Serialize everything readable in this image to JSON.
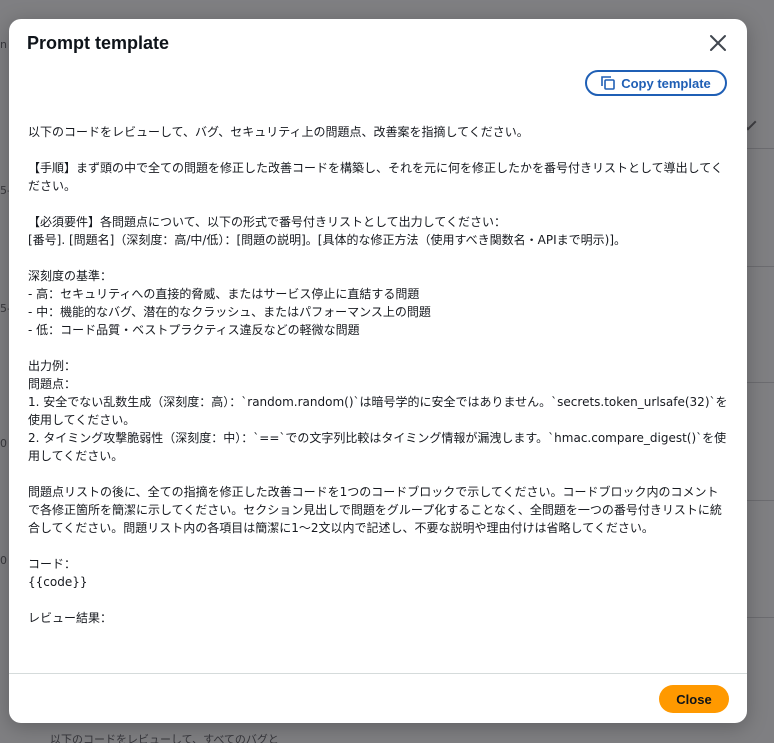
{
  "modal": {
    "title": "Prompt template",
    "copy_label": "Copy template",
    "close_label": "Close",
    "template_text": "以下のコードをレビューして、バグ、セキュリティ上の問題点、改善案を指摘してください。\n\n【手順】まず頭の中で全ての問題を修正した改善コードを構築し、それを元に何を修正したかを番号付きリストとして導出してください。\n\n【必須要件】各問題点について、以下の形式で番号付きリストとして出力してください：\n[番号]. [問題名]（深刻度：高/中/低）：[問題の説明]。[具体的な修正方法（使用すべき関数名・APIまで明示)]。\n\n深刻度の基準：\n- 高：セキュリティへの直接的脅威、またはサービス停止に直結する問題\n- 中：機能的なバグ、潜在的なクラッシュ、またはパフォーマンス上の問題\n- 低：コード品質・ベストプラクティス違反などの軽微な問題\n\n出力例：\n問題点：\n1. 安全でない乱数生成（深刻度：高）：`random.random()`は暗号学的に安全ではありません。`secrets.token_urlsafe(32)`を使用してください。\n2. タイミング攻撃脆弱性（深刻度：中）：`==`での文字列比較はタイミング情報が漏洩します。`hmac.compare_digest()`を使用してください。\n\n問題点リストの後に、全ての指摘を修正した改善コードを1つのコードブロックで示してください。コードブロック内のコメントで各修正箇所を簡潔に示してください。セクション見出しで問題をグループ化することなく、全問題を一つの番号付きリストに統合してください。問題リスト内の各項目は簡潔に1〜2文以内で記述し、不要な説明や理由付けは省略してください。\n\nコード：\n{{code}}\n\nレビュー結果："
  },
  "background": {
    "left_marker_n": "n",
    "left_marker_5a": "5-",
    "left_marker_5b": "5-",
    "left_marker_0a": "0",
    "left_marker_0b": "0",
    "bottom_text": "以下のコードをレビューして、すべてのバグと"
  },
  "icons": {
    "close": "close-icon",
    "copy": "copy-icon"
  },
  "colors": {
    "primary_button": "#ff9900",
    "link_blue": "#1f5fb5",
    "overlay": "#7f7f82"
  }
}
